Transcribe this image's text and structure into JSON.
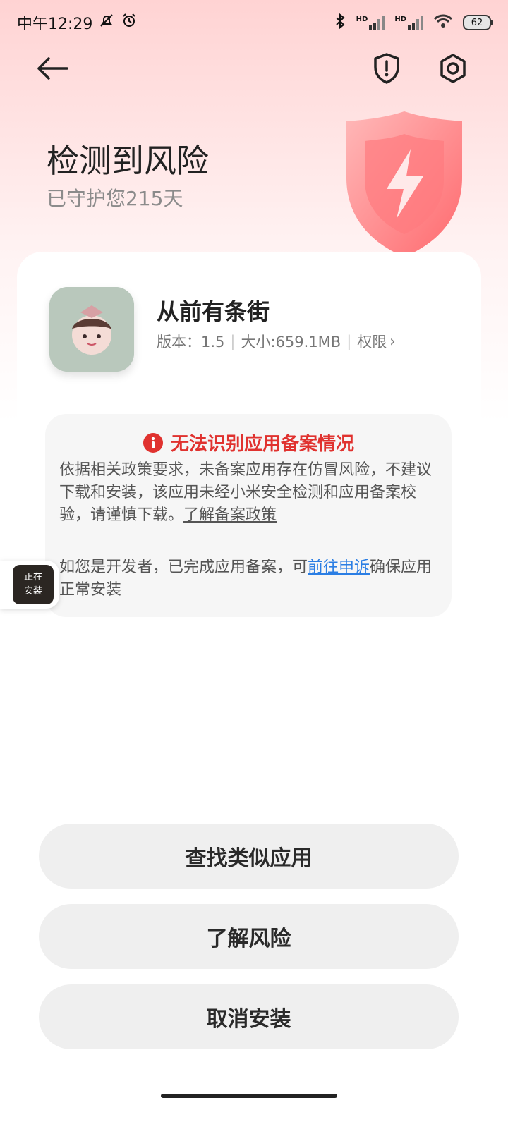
{
  "status_bar": {
    "time": "中午12:29",
    "hd1": "HD",
    "hd2": "HD",
    "battery": "62"
  },
  "header": {
    "title": "检测到风险",
    "subtitle": "已守护您215天"
  },
  "app": {
    "name": "从前有条街",
    "version": "版本：1.5",
    "size": "大小:659.1MB",
    "permissions": "权限",
    "permissions_chevron": "›"
  },
  "warning": {
    "title": "无法识别应用备案情况",
    "body": "依据相关政策要求，未备案应用存在仿冒风险，不建议下载和安装，该应用未经小米安全检测和应用备案校验，请谨慎下载。",
    "policy_link": "了解备案政策",
    "dev_note_prefix": "如您是开发者，已完成应用备案，可",
    "appeal_link": "前往申诉",
    "dev_note_suffix": "确保应用正常安装"
  },
  "floating_install": {
    "line1": "正在",
    "line2": "安装"
  },
  "actions": {
    "find_similar": "查找类似应用",
    "learn_risk": "了解风险",
    "cancel_install": "取消安装"
  },
  "colors": {
    "warning_red": "#e0322f",
    "link_blue": "#2b7ee4",
    "button_bg": "#efefef"
  }
}
